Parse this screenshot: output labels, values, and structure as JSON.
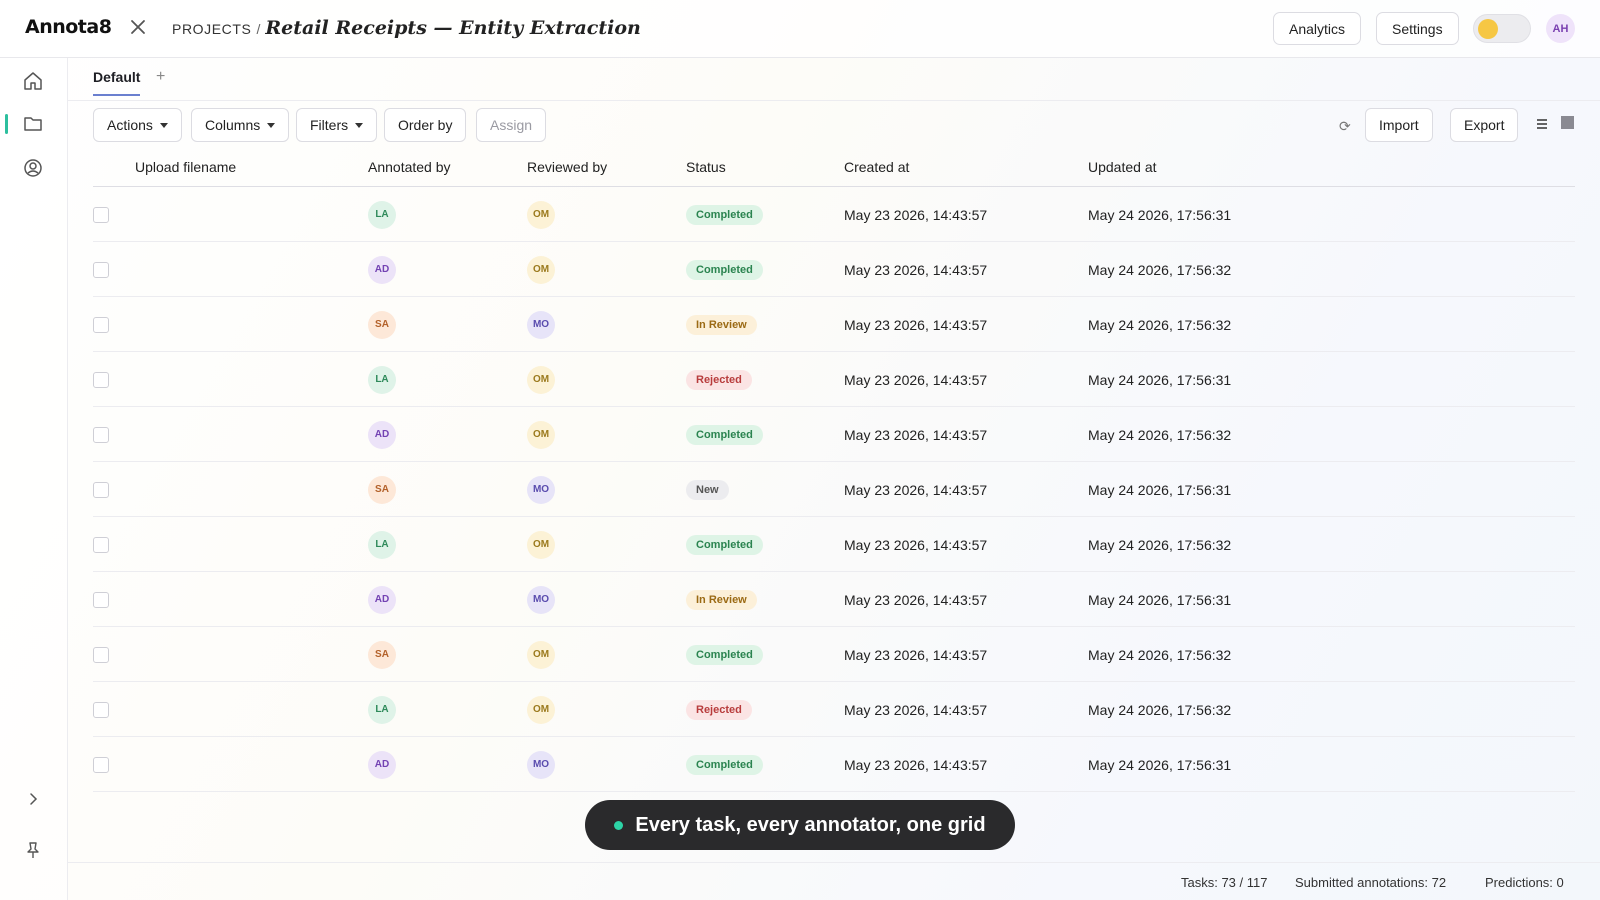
{
  "app": {
    "logo": "Annota8"
  },
  "breadcrumb": {
    "root": "PROJECTS",
    "separator": "/",
    "title": "Retail Receipts — Entity Extraction"
  },
  "header": {
    "analytics_label": "Analytics",
    "settings_label": "Settings",
    "theme_toggle": "light",
    "user_initials": "AH"
  },
  "sidebar": {
    "items": [
      "home-icon",
      "folder-icon",
      "user-circle-icon"
    ],
    "active_item": "folder-icon",
    "bottom": [
      "chevron-right-icon",
      "pin-icon"
    ]
  },
  "tabs": {
    "items": [
      {
        "label": "Default"
      }
    ],
    "add_label": "+"
  },
  "toolbar": {
    "actions_label": "Actions",
    "columns_label": "Columns",
    "filters_label": "Filters",
    "order_label": "Order by",
    "assign_label": "Assign",
    "refresh_glyph": "⟳",
    "import_label": "Import",
    "export_label": "Export"
  },
  "table": {
    "headers": {
      "filename": "Upload filename",
      "annotated": "Annotated by",
      "reviewed": "Reviewed by",
      "status": "Status",
      "created": "Created at",
      "updated": "Updated at"
    },
    "rows": [
      {
        "annotated": "LA",
        "reviewed": "OM",
        "status": "Completed",
        "created": "May 23 2026, 14:43:57",
        "updated": "May 24 2026, 17:56:31"
      },
      {
        "annotated": "AD",
        "reviewed": "OM",
        "status": "Completed",
        "created": "May 23 2026, 14:43:57",
        "updated": "May 24 2026, 17:56:32"
      },
      {
        "annotated": "SA",
        "reviewed": "MO",
        "status": "In Review",
        "created": "May 23 2026, 14:43:57",
        "updated": "May 24 2026, 17:56:32"
      },
      {
        "annotated": "LA",
        "reviewed": "OM",
        "status": "Rejected",
        "created": "May 23 2026, 14:43:57",
        "updated": "May 24 2026, 17:56:31"
      },
      {
        "annotated": "AD",
        "reviewed": "OM",
        "status": "Completed",
        "created": "May 23 2026, 14:43:57",
        "updated": "May 24 2026, 17:56:32"
      },
      {
        "annotated": "SA",
        "reviewed": "MO",
        "status": "New",
        "created": "May 23 2026, 14:43:57",
        "updated": "May 24 2026, 17:56:31"
      },
      {
        "annotated": "LA",
        "reviewed": "OM",
        "status": "Completed",
        "created": "May 23 2026, 14:43:57",
        "updated": "May 24 2026, 17:56:32"
      },
      {
        "annotated": "AD",
        "reviewed": "MO",
        "status": "In Review",
        "created": "May 23 2026, 14:43:57",
        "updated": "May 24 2026, 17:56:31"
      },
      {
        "annotated": "SA",
        "reviewed": "OM",
        "status": "Completed",
        "created": "May 23 2026, 14:43:57",
        "updated": "May 24 2026, 17:56:32"
      },
      {
        "annotated": "LA",
        "reviewed": "OM",
        "status": "Rejected",
        "created": "May 23 2026, 14:43:57",
        "updated": "May 24 2026, 17:56:32"
      },
      {
        "annotated": "AD",
        "reviewed": "MO",
        "status": "Completed",
        "created": "May 23 2026, 14:43:57",
        "updated": "May 24 2026, 17:56:31"
      }
    ]
  },
  "caption": {
    "text": "Every task, every annotator, one grid"
  },
  "footer": {
    "tasks": "Tasks: 73 / 117",
    "submitted": "Submitted annotations: 72",
    "predictions": "Predictions: 0"
  },
  "colors": {
    "accent": "#2dbf9e",
    "tab_underline": "#6a7fcf",
    "caption_bg": "#2a2a2c"
  }
}
